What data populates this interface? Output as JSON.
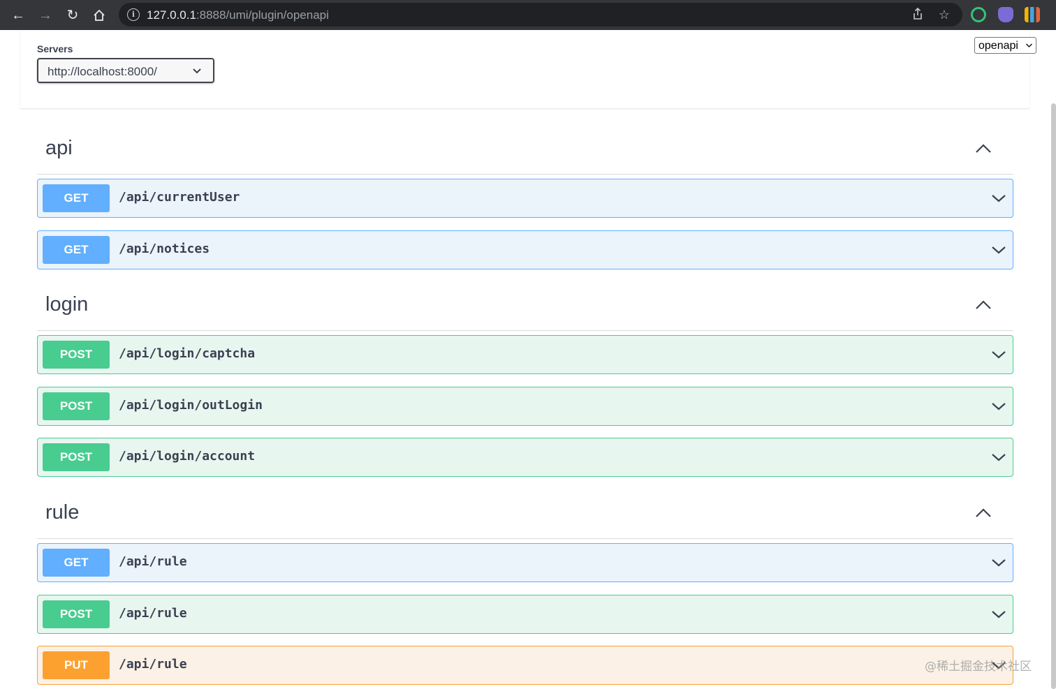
{
  "browser": {
    "url_host": "127.0.0.1",
    "url_rest": ":8888/umi/plugin/openapi"
  },
  "servers": {
    "label": "Servers",
    "selected": "http://localhost:8000/"
  },
  "spec_select": {
    "selected": "openapi"
  },
  "tags": [
    {
      "name": "api",
      "operations": [
        {
          "method": "GET",
          "path": "/api/currentUser"
        },
        {
          "method": "GET",
          "path": "/api/notices"
        }
      ]
    },
    {
      "name": "login",
      "operations": [
        {
          "method": "POST",
          "path": "/api/login/captcha"
        },
        {
          "method": "POST",
          "path": "/api/login/outLogin"
        },
        {
          "method": "POST",
          "path": "/api/login/account"
        }
      ]
    },
    {
      "name": "rule",
      "operations": [
        {
          "method": "GET",
          "path": "/api/rule"
        },
        {
          "method": "POST",
          "path": "/api/rule"
        },
        {
          "method": "PUT",
          "path": "/api/rule"
        }
      ]
    }
  ],
  "watermark": "@稀土掘金技术社区",
  "colors": {
    "get": "#61affe",
    "post": "#49cc90",
    "put": "#fca130"
  }
}
